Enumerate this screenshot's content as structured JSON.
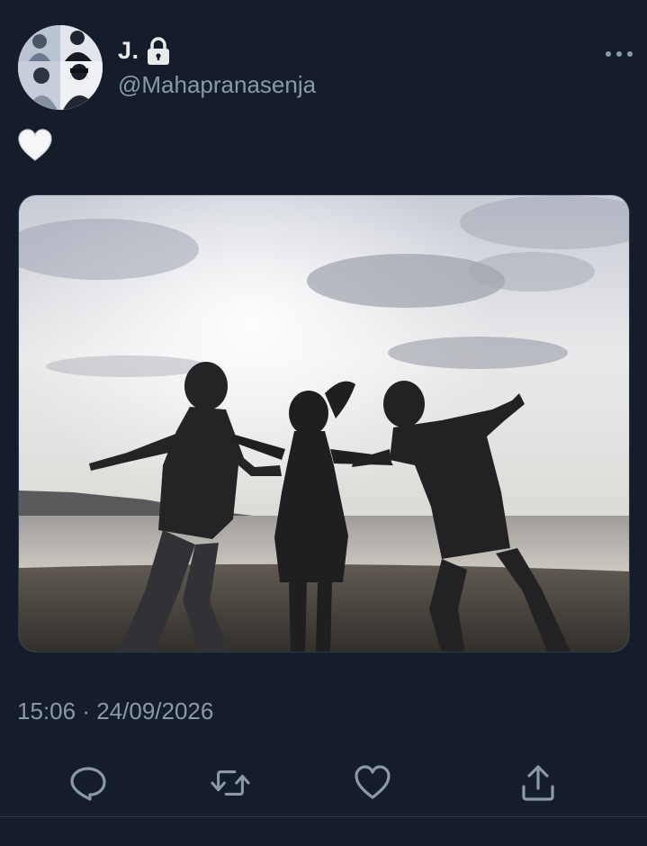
{
  "author": {
    "display_name": "J.",
    "handle": "@Mahapranasenja",
    "protected_icon": "lock-icon",
    "avatar": "profile-photo-avatar"
  },
  "tweet": {
    "text_icon": "white-heart-emoji",
    "media": "beach-silhouette-photo",
    "time": "15:06",
    "separator": "·",
    "date": "24/09/2026"
  },
  "actions": [
    {
      "name": "reply",
      "icon": "reply-icon"
    },
    {
      "name": "retweet",
      "icon": "retweet-icon"
    },
    {
      "name": "like",
      "icon": "heart-icon"
    },
    {
      "name": "share",
      "icon": "share-icon"
    }
  ],
  "colors": {
    "background": "#151d2b",
    "primary_text": "#e7e9ea",
    "secondary_text": "#8b98a5",
    "border": "#2f3a48"
  }
}
